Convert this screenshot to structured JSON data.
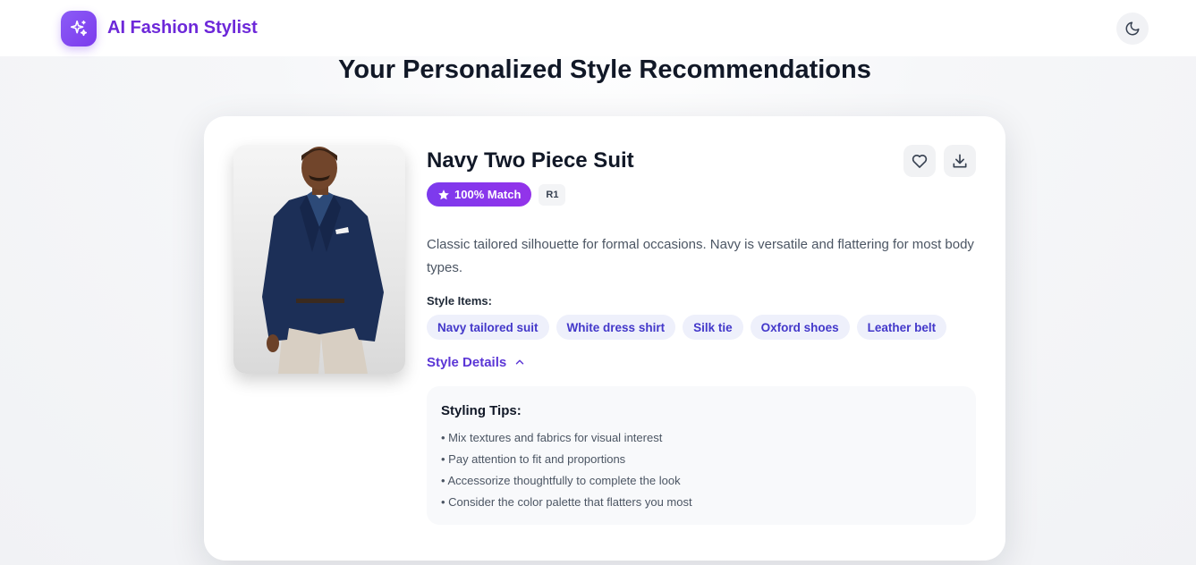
{
  "app": {
    "name": "AI Fashion Stylist",
    "brand_color": "#7c3aed"
  },
  "header": {
    "theme_toggle_icon": "moon-icon"
  },
  "page": {
    "title": "Your Personalized Style Recommendations"
  },
  "recommendation": {
    "title": "Navy Two Piece Suit",
    "match_label": "100% Match",
    "rank": "R1",
    "description": "Classic tailored silhouette for formal occasions. Navy is versatile and flattering for most body types.",
    "style_items_label": "Style Items:",
    "style_items": [
      "Navy tailored suit",
      "White dress shirt",
      "Silk tie",
      "Oxford shoes",
      "Leather belt"
    ],
    "details_toggle_label": "Style Details",
    "details_expanded": true,
    "tips_title": "Styling Tips:",
    "tips": [
      "• Mix textures and fabrics for visual interest",
      "• Pay attention to fit and proportions",
      "• Accessorize thoughtfully to complete the look",
      "• Consider the color palette that flatters you most"
    ],
    "actions": {
      "favorite_icon": "heart-icon",
      "download_icon": "download-icon"
    }
  }
}
